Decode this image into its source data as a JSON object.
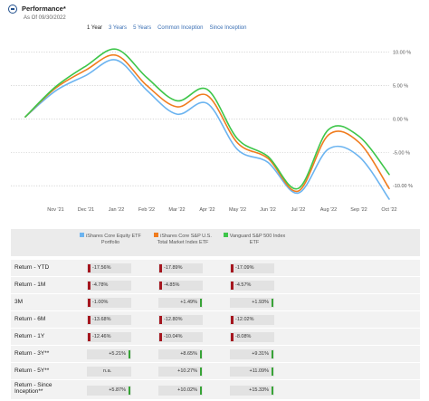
{
  "header": {
    "title": "Performance*",
    "as_of": "As Of 09/30/2022"
  },
  "periods": [
    "1 Year",
    "3 Years",
    "5 Years",
    "Common Inception",
    "Since Inception"
  ],
  "active_period": "1 Year",
  "colors": {
    "ishares": "#6cb4f0",
    "ishares_sp": "#f07c1e",
    "vanguard": "#3ec64a",
    "negative": "#a5161f",
    "positive": "#38a337"
  },
  "chart_data": {
    "type": "line",
    "x": [
      "Oct '21",
      "Nov '21",
      "Dec '21",
      "Jan '22",
      "Feb '22",
      "Mar '22",
      "Apr '22",
      "May '22",
      "Jun '22",
      "Jul '22",
      "Aug '22",
      "Sep '22",
      "Oct '22"
    ],
    "x_ticks": [
      "Nov '21",
      "Dec '21",
      "Jan '22",
      "Feb '22",
      "Mar '22",
      "Apr '22",
      "May '22",
      "Jun '22",
      "Jul '22",
      "Aug '22",
      "Sep '22",
      "Oct '22"
    ],
    "ylim": [
      -12,
      11
    ],
    "y_ticks": [
      10,
      5,
      0,
      -5,
      -10
    ],
    "y_tick_labels": [
      "10.00 %",
      "5.00 %",
      "0.00 %",
      "-5.00 %",
      "-10.00 %"
    ],
    "series": [
      {
        "name": "iShares Core Equity ETF Portfolio",
        "color_key": "ishares",
        "values": [
          0.3,
          4.2,
          6.5,
          8.8,
          4.3,
          0.7,
          2.3,
          -4.6,
          -6.5,
          -11.1,
          -4.5,
          -5.6,
          -12.0
        ]
      },
      {
        "name": "iShares Core S&P U.S. Total Market Index ETF",
        "color_key": "ishares_sp",
        "values": [
          0.3,
          4.6,
          7.3,
          9.5,
          5.0,
          1.8,
          3.5,
          -3.6,
          -5.9,
          -10.8,
          -2.4,
          -3.5,
          -10.4
        ]
      },
      {
        "name": "Vanguard S&P 500 Index ETF",
        "color_key": "vanguard",
        "values": [
          0.3,
          4.8,
          7.9,
          10.4,
          6.2,
          2.7,
          4.4,
          -3.0,
          -5.6,
          -10.4,
          -1.6,
          -2.6,
          -8.3
        ]
      }
    ]
  },
  "table": {
    "columns": [
      {
        "label": "iShares Core Equity ETF Portfolio",
        "color_key": "ishares"
      },
      {
        "label": "iShares Core S&P U.S. Total Market Index ETF",
        "color_key": "ishares_sp"
      },
      {
        "label": "Vanguard S&P 500 Index ETF",
        "color_key": "vanguard"
      }
    ],
    "rows": [
      {
        "label": "Return - YTD",
        "values": [
          "-17.56%",
          "-17.89%",
          "-17.09%"
        ],
        "nums": [
          -17.56,
          -17.89,
          -17.09
        ]
      },
      {
        "label": "Return - 1M",
        "values": [
          "-4.78%",
          "-4.85%",
          "-4.57%"
        ],
        "nums": [
          -4.78,
          -4.85,
          -4.57
        ]
      },
      {
        "label": "3M",
        "values": [
          "-1.00%",
          "+1.49%",
          "+1.93%"
        ],
        "nums": [
          -1.0,
          1.49,
          1.93
        ]
      },
      {
        "label": "Return - 6M",
        "values": [
          "-13.68%",
          "-12.80%",
          "-12.02%"
        ],
        "nums": [
          -13.68,
          -12.8,
          -12.02
        ]
      },
      {
        "label": "Return - 1Y",
        "values": [
          "-12.46%",
          "-10.04%",
          "-8.08%"
        ],
        "nums": [
          -12.46,
          -10.04,
          -8.08
        ]
      },
      {
        "label": "Return - 3Y**",
        "values": [
          "+5.21%",
          "+8.65%",
          "+9.31%"
        ],
        "nums": [
          5.21,
          8.65,
          9.31
        ]
      },
      {
        "label": "Return - 5Y**",
        "values": [
          "n.a.",
          "+10.27%",
          "+11.09%"
        ],
        "nums": [
          null,
          10.27,
          11.09
        ]
      },
      {
        "label": "Return - Since Inception**",
        "values": [
          "+5.87%",
          "+10.02%",
          "+15.33%"
        ],
        "nums": [
          5.87,
          10.02,
          15.33
        ]
      }
    ]
  }
}
